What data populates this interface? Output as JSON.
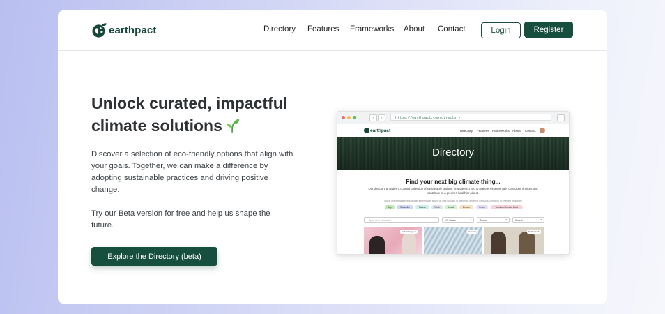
{
  "brand": {
    "name": "earthpact",
    "color": "#17463a"
  },
  "nav": {
    "links": [
      "Directory",
      "Features",
      "Frameworks",
      "About",
      "Contact"
    ],
    "login_label": "Login",
    "register_label": "Register"
  },
  "hero": {
    "title": "Unlock curated, impactful climate solutions",
    "title_icon": "sprout-icon",
    "paragraph_1": "Discover a selection of eco-friendly options that align with your goals. Together, we can make a difference by adopting sustainable practices and driving positive change.",
    "paragraph_2": "Try our Beta version for free and help us shape the future.",
    "cta_label": "Explore the Directory (beta)"
  },
  "preview": {
    "url": "https://earthpact.com/directory",
    "brand": "earthpact",
    "nav_links": [
      "Directory",
      "Features",
      "Frameworks",
      "About",
      "Contact"
    ],
    "banner_title": "Directory",
    "heading": "Find your next big climate thing...",
    "subtext": "Our directory provides a curated collection of sustainable options, empowering you to make environmentally conscious choices and contribute to a greener, healthier planet.",
    "hint": "Stuck, use the tags below or filter the products based on your industry or search for anything (products, company, or relevant keywords)",
    "chips": [
      "Buy",
      "Subscribe",
      "Partner",
      "Work",
      "Invest",
      "Donate",
      "Learn",
      "Vacation/Remote Work"
    ],
    "search_placeholder": "Type here to search",
    "filters": [
      "UN Goals",
      "Sector",
      "Country"
    ],
    "card_tags": [
      "United Kingdom",
      "Germany",
      "Netherlands"
    ]
  },
  "colors": {
    "primary": "#164f3e",
    "background_start": "#b9bff0",
    "background_end": "#f6f7fc"
  }
}
